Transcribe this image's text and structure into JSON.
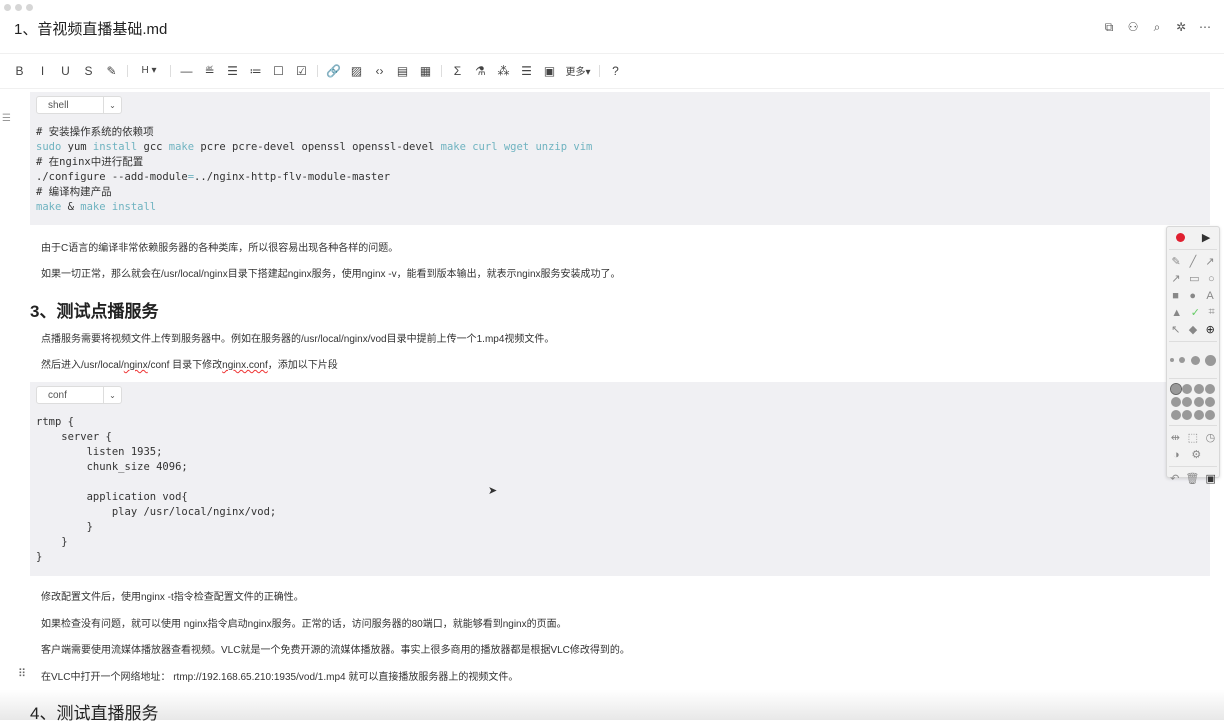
{
  "window": {
    "title": "1、音视频直播基础.md"
  },
  "header_icons": [
    "outline-view-icon",
    "share-user-icon",
    "search-replace-icon",
    "mindmap-icon",
    "more-icon"
  ],
  "toolbar": {
    "items": [
      {
        "name": "bold",
        "glyph": "B"
      },
      {
        "name": "italic",
        "glyph": "I"
      },
      {
        "name": "underline",
        "glyph": "U"
      },
      {
        "name": "strikethrough",
        "glyph": "S"
      },
      {
        "name": "highlight",
        "glyph": "✎"
      },
      "sep",
      {
        "name": "heading",
        "glyph": "H ▾"
      },
      "sep",
      {
        "name": "horizontal-rule",
        "glyph": "—"
      },
      {
        "name": "quote",
        "glyph": "≝"
      },
      {
        "name": "bullet-list",
        "glyph": "☰"
      },
      {
        "name": "ordered-list",
        "glyph": "≔"
      },
      {
        "name": "checkbox",
        "glyph": "☐"
      },
      {
        "name": "task",
        "glyph": "☑"
      },
      "sep",
      {
        "name": "link",
        "glyph": "🔗"
      },
      {
        "name": "image",
        "glyph": "▨"
      },
      {
        "name": "inline-code",
        "glyph": "‹›"
      },
      {
        "name": "code-block",
        "glyph": "▤"
      },
      {
        "name": "table",
        "glyph": "▦"
      },
      "sep",
      {
        "name": "formula",
        "glyph": "Σ"
      },
      {
        "name": "flask",
        "glyph": "⚗"
      },
      {
        "name": "diagram",
        "glyph": "⁂"
      },
      {
        "name": "toc",
        "glyph": "☰"
      },
      {
        "name": "file",
        "glyph": "▣"
      },
      {
        "name": "more",
        "glyph": "更多▾"
      },
      "sep",
      {
        "name": "help",
        "glyph": "?"
      }
    ]
  },
  "block1": {
    "lang": "shell",
    "lines": [
      [
        [
          "# 安装操作系统的依赖项",
          ""
        ]
      ],
      [
        [
          "sudo",
          "k"
        ],
        [
          " yum ",
          ""
        ],
        [
          "install",
          "k"
        ],
        [
          " gcc ",
          ""
        ],
        [
          "make",
          "k"
        ],
        [
          " pcre pcre-devel openssl openssl-devel ",
          ""
        ],
        [
          "make curl wget unzip vim",
          "k"
        ]
      ],
      [
        [
          "# 在nginx中进行配置",
          ""
        ]
      ],
      [
        [
          "./configure --add-module",
          ""
        ],
        [
          "=",
          "k"
        ],
        [
          "../nginx-http-flv-module-master",
          ""
        ]
      ],
      [
        [
          "# 编译构建产品",
          ""
        ]
      ],
      [
        [
          "make",
          "k"
        ],
        [
          " & ",
          ""
        ],
        [
          "make install",
          "k"
        ]
      ]
    ]
  },
  "para1": "由于C语言的编译非常依赖服务器的各种类库，所以很容易出现各种各样的问题。",
  "para2": "如果一切正常，那么就会在/usr/local/nginx目录下搭建起nginx服务，使用nginx -v，能看到版本输出，就表示nginx服务安装成功了。",
  "heading3": "3、测试点播服务",
  "para3": "点播服务需要将视频文件上传到服务器中。例如在服务器的/usr/local/nginx/vod目录中提前上传一个1.mp4视频文件。",
  "para4": {
    "a": "然后进入/usr/local/",
    "b": "nginx",
    "c": "/conf 目录下修改",
    "d": "nginx.conf",
    "e": "，添加以下片段"
  },
  "block2": {
    "lang": "conf",
    "lines": [
      [
        [
          "rtmp {",
          ""
        ]
      ],
      [
        [
          "    server {",
          ""
        ]
      ],
      [
        [
          "        listen 1935;",
          ""
        ]
      ],
      [
        [
          "        chunk_size 4096;",
          ""
        ]
      ],
      [
        [
          "",
          ""
        ]
      ],
      [
        [
          "        application vod{",
          ""
        ]
      ],
      [
        [
          "            play /usr/local/nginx/vod;",
          ""
        ]
      ],
      [
        [
          "        }",
          ""
        ]
      ],
      [
        [
          "    }",
          ""
        ]
      ],
      [
        [
          "}",
          ""
        ]
      ]
    ]
  },
  "para5": "修改配置文件后，使用nginx -t指令检查配置文件的正确性。",
  "para6": "如果检查没有问题，就可以使用 nginx指令启动nginx服务。正常的话，访问服务器的80端口，就能够看到nginx的页面。",
  "para7": "客户端需要使用流媒体播放器查看视频。VLC就是一个免费开源的流媒体播放器。事实上很多商用的播放器都是根据VLC修改得到的。",
  "para8": "在VLC中打开一个网络地址： rtmp://192.168.65.210:1935/vod/1.mp4 就可以直接播放服务器上的视频文件。",
  "heading4": "4、测试直播服务",
  "colors": {
    "keyword": "#6fb3c0",
    "code_bg": "#f0f0f3",
    "record": "#e02030"
  }
}
